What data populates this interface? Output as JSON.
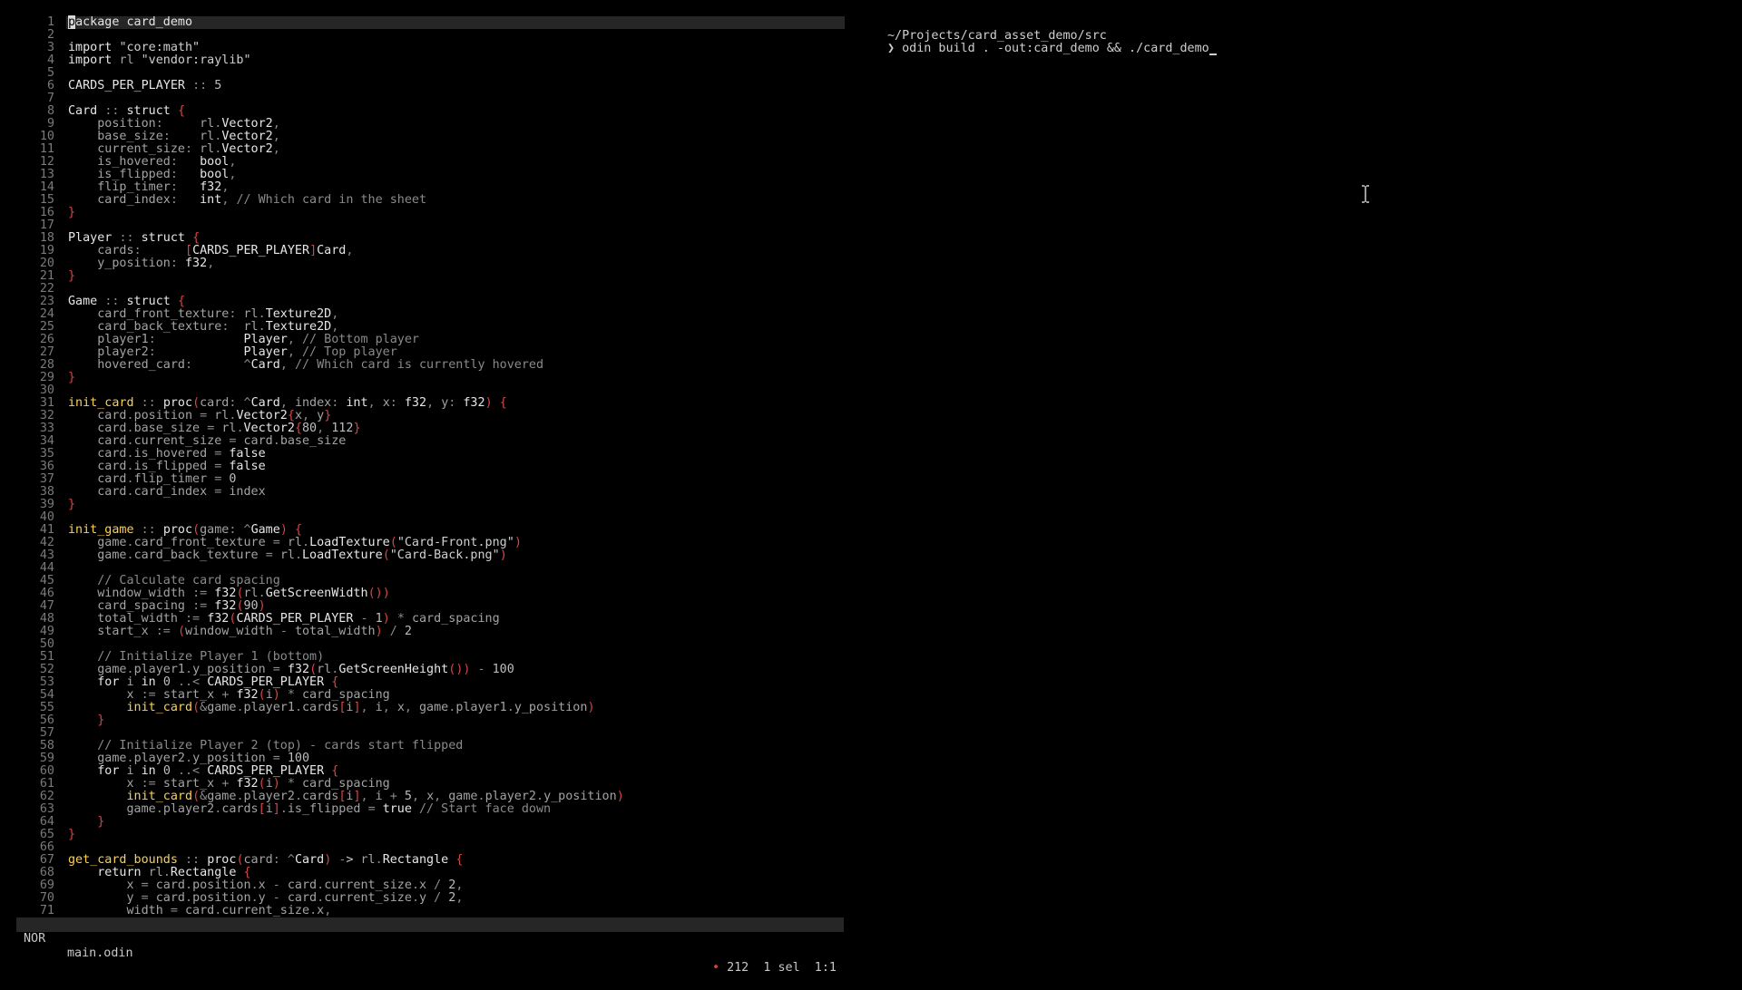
{
  "editor": {
    "statusbar": {
      "mode": "NOR",
      "filename": "main.odin",
      "modified_dot": "•",
      "selection_info": "212  1 sel  1:1"
    },
    "line_numbers": [
      "1",
      "2",
      "3",
      "4",
      "5",
      "6",
      "7",
      "8",
      "9",
      "10",
      "11",
      "12",
      "13",
      "14",
      "15",
      "16",
      "17",
      "18",
      "19",
      "20",
      "21",
      "22",
      "23",
      "24",
      "25",
      "26",
      "27",
      "28",
      "29",
      "30",
      "31",
      "32",
      "33",
      "34",
      "35",
      "36",
      "37",
      "38",
      "39",
      "40",
      "41",
      "42",
      "43",
      "44",
      "45",
      "46",
      "47",
      "48",
      "49",
      "50",
      "51",
      "52",
      "53",
      "54",
      "55",
      "56",
      "57",
      "58",
      "59",
      "60",
      "61",
      "62",
      "63",
      "64",
      "65",
      "66",
      "67",
      "68",
      "69",
      "70",
      "71"
    ],
    "code": [
      {
        "cursor": "p",
        "rest": "ackage card_demo"
      },
      {
        "text": ""
      },
      {
        "text": "import \"core:math\""
      },
      {
        "text": "import rl \"vendor:raylib\""
      },
      {
        "text": ""
      },
      {
        "text": "CARDS_PER_PLAYER :: 5"
      },
      {
        "text": ""
      },
      {
        "text": "Card :: struct {"
      },
      {
        "text": "    position:     rl.Vector2,"
      },
      {
        "text": "    base_size:    rl.Vector2,"
      },
      {
        "text": "    current_size: rl.Vector2,"
      },
      {
        "text": "    is_hovered:   bool,"
      },
      {
        "text": "    is_flipped:   bool,"
      },
      {
        "text": "    flip_timer:   f32,"
      },
      {
        "text": "    card_index:   int, // Which card in the sheet"
      },
      {
        "text": "}"
      },
      {
        "text": ""
      },
      {
        "text": "Player :: struct {"
      },
      {
        "text": "    cards:      [CARDS_PER_PLAYER]Card,"
      },
      {
        "text": "    y_position: f32,"
      },
      {
        "text": "}"
      },
      {
        "text": ""
      },
      {
        "text": "Game :: struct {"
      },
      {
        "text": "    card_front_texture: rl.Texture2D,"
      },
      {
        "text": "    card_back_texture:  rl.Texture2D,"
      },
      {
        "text": "    player1:            Player, // Bottom player"
      },
      {
        "text": "    player2:            Player, // Top player"
      },
      {
        "text": "    hovered_card:       ^Card, // Which card is currently hovered"
      },
      {
        "text": "}"
      },
      {
        "text": ""
      },
      {
        "text": "init_card :: proc(card: ^Card, index: int, x: f32, y: f32) {"
      },
      {
        "text": "    card.position = rl.Vector2{x, y}"
      },
      {
        "text": "    card.base_size = rl.Vector2{80, 112}"
      },
      {
        "text": "    card.current_size = card.base_size"
      },
      {
        "text": "    card.is_hovered = false"
      },
      {
        "text": "    card.is_flipped = false"
      },
      {
        "text": "    card.flip_timer = 0"
      },
      {
        "text": "    card.card_index = index"
      },
      {
        "text": "}"
      },
      {
        "text": ""
      },
      {
        "text": "init_game :: proc(game: ^Game) {"
      },
      {
        "text": "    game.card_front_texture = rl.LoadTexture(\"Card-Front.png\")"
      },
      {
        "text": "    game.card_back_texture = rl.LoadTexture(\"Card-Back.png\")"
      },
      {
        "text": ""
      },
      {
        "text": "    // Calculate card spacing"
      },
      {
        "text": "    window_width := f32(rl.GetScreenWidth())"
      },
      {
        "text": "    card_spacing := f32(90)"
      },
      {
        "text": "    total_width := f32(CARDS_PER_PLAYER - 1) * card_spacing"
      },
      {
        "text": "    start_x := (window_width - total_width) / 2"
      },
      {
        "text": ""
      },
      {
        "text": "    // Initialize Player 1 (bottom)"
      },
      {
        "text": "    game.player1.y_position = f32(rl.GetScreenHeight()) - 100"
      },
      {
        "text": "    for i in 0 ..< CARDS_PER_PLAYER {"
      },
      {
        "text": "        x := start_x + f32(i) * card_spacing"
      },
      {
        "text": "        init_card(&game.player1.cards[i], i, x, game.player1.y_position)"
      },
      {
        "text": "    }"
      },
      {
        "text": ""
      },
      {
        "text": "    // Initialize Player 2 (top) - cards start flipped"
      },
      {
        "text": "    game.player2.y_position = 100"
      },
      {
        "text": "    for i in 0 ..< CARDS_PER_PLAYER {"
      },
      {
        "text": "        x := start_x + f32(i) * card_spacing"
      },
      {
        "text": "        init_card(&game.player2.cards[i], i + 5, x, game.player2.y_position)"
      },
      {
        "text": "        game.player2.cards[i].is_flipped = true // Start face down"
      },
      {
        "text": "    }"
      },
      {
        "text": "}"
      },
      {
        "text": ""
      },
      {
        "text": "get_card_bounds :: proc(card: ^Card) -> rl.Rectangle {"
      },
      {
        "text": "    return rl.Rectangle {"
      },
      {
        "text": "        x = card.position.x - card.current_size.x / 2,"
      },
      {
        "text": "        y = card.position.y - card.current_size.y / 2,"
      },
      {
        "text": "        width = card.current_size.x,"
      }
    ]
  },
  "terminal": {
    "cwd": "~/Projects/card_asset_demo/src",
    "prompt_symbol": "❯",
    "command": " odin build . -out:card_demo && ./card_demo"
  }
}
